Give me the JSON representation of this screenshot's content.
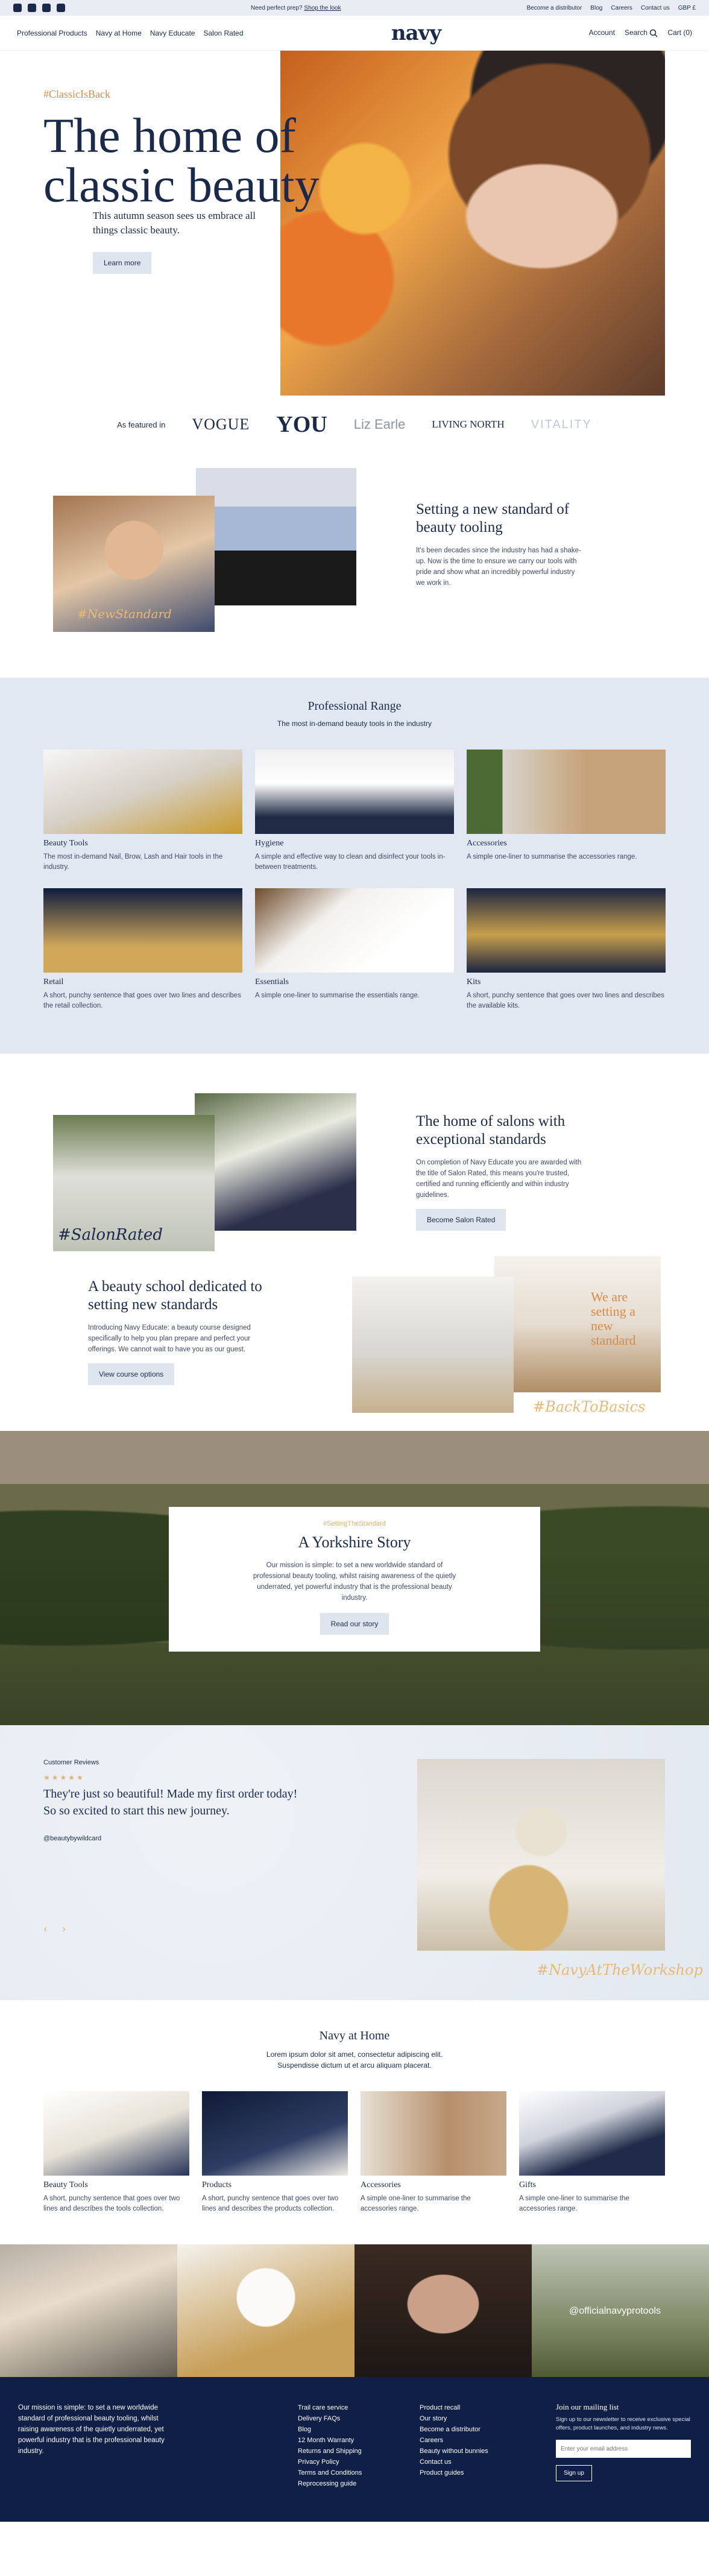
{
  "utility": {
    "promo_text": "Need perfect prep?",
    "promo_link": "Shop the look",
    "links": [
      "Become a distributor",
      "Blog",
      "Careers",
      "Contact us",
      "GBP £"
    ]
  },
  "header": {
    "nav": [
      "Professional Products",
      "Navy at Home",
      "Navy Educate",
      "Salon Rated"
    ],
    "logo": "navy",
    "tools": {
      "account": "Account",
      "search": "Search",
      "cart": "Cart"
    },
    "cart_count": "(0)"
  },
  "hero": {
    "hashtag": "#ClassicIsBack",
    "title": "The home of classic beauty",
    "subtitle": "This autumn season sees us embrace all things classic beauty.",
    "cta": "Learn more"
  },
  "featured": {
    "label": "As featured in",
    "brands": [
      "VOGUE",
      "YOU",
      "Liz Earle",
      "LIVING NORTH",
      "VITALITY"
    ]
  },
  "standard": {
    "script": "#NewStandard",
    "title": "Setting a new standard of beauty tooling",
    "body": "It's been decades since the industry has had a shake-up. Now is the time to ensure we carry our tools with pride and show what an incredibly powerful industry we work in."
  },
  "range": {
    "title": "Professional Range",
    "lede": "The most in-demand beauty tools in the industry",
    "items": [
      {
        "title": "Beauty Tools",
        "desc": "The most in-demand Nail, Brow, Lash and Hair tools in the industry."
      },
      {
        "title": "Hygiene",
        "desc": "A simple and effective way to clean and disinfect your tools in-between treatments."
      },
      {
        "title": "Accessories",
        "desc": "A simple one-liner to summarise the accessories range."
      },
      {
        "title": "Retail",
        "desc": "A short, punchy sentence that goes over two lines and describes the retail collection."
      },
      {
        "title": "Essentials",
        "desc": "A simple one-liner to summarise the essentials range."
      },
      {
        "title": "Kits",
        "desc": "A short, punchy sentence that goes over two lines and describes the available kits."
      }
    ]
  },
  "salons": {
    "script": "#SalonRated",
    "title": "The home of salons with exceptional standards",
    "body": "On completion of Navy Educate you are awarded with the title of Salon Rated, this means you're trusted, certified and running efficiently and within industry guidelines.",
    "cta": "Become Salon Rated"
  },
  "school": {
    "script": "#BackToBasics",
    "title": "A beauty school dedicated to setting new standards",
    "body": "Introducing Navy Educate: a beauty course designed specifically to help you plan prepare and perfect your offerings. We cannot wait to have you as our guest.",
    "cta": "View course options",
    "sign": "We are setting a new standard"
  },
  "yorkshire": {
    "hashtag": "#SettingTheStandard",
    "title": "A Yorkshire Story",
    "body": "Our mission is simple: to set a new worldwide standard of professional beauty tooling, whilst raising awareness of the quietly underrated, yet powerful industry that is the professional beauty industry.",
    "cta": "Read our story"
  },
  "review": {
    "kicker": "Customer Reviews",
    "stars": "★★★★★",
    "quote": "They're just so beautiful! Made my first order today! So so excited to start this new journey.",
    "handle": "@beautybywildcard",
    "script": "#NavyAtTheWorkshop",
    "prev": "‹",
    "next": "›"
  },
  "home": {
    "title": "Navy at Home",
    "lede": "Lorem ipsum dolor sit amet, consectetur adipiscing elit. Suspendisse dictum ut et arcu aliquam placerat.",
    "items": [
      {
        "title": "Beauty Tools",
        "desc": "A short, punchy sentence that goes over two lines and describes the tools collection."
      },
      {
        "title": "Products",
        "desc": "A short, punchy sentence that goes over two lines and describes the products collection."
      },
      {
        "title": "Accessories",
        "desc": "A simple one-liner to summarise the accessories range."
      },
      {
        "title": "Gifts",
        "desc": "A simple one-liner to summarise the accessories range."
      }
    ]
  },
  "insta": {
    "handle": "@officialnavyprotools"
  },
  "footer": {
    "mission": "Our mission is simple: to set a new worldwide standard of professional beauty tooling, whilst raising awareness of the quietly underrated, yet powerful industry that is the professional beauty industry.",
    "col1": [
      "Trail care service",
      "Delivery FAQs",
      "Blog",
      "12 Month Warranty",
      "Returns and Shipping",
      "Privacy Policy",
      "Terms and Conditions",
      "Reprocessing guide"
    ],
    "col2": [
      "Product recall",
      "Our story",
      "Become a distributor",
      "Careers",
      "Beauty without bunnies",
      "Contact us",
      "Product guides"
    ],
    "news": {
      "title": "Join our mailing list",
      "desc": "Sign up to our newsletter to receive exclusive special offers, product launches, and industry news.",
      "placeholder": "Enter your email address",
      "cta": "Sign up"
    }
  }
}
